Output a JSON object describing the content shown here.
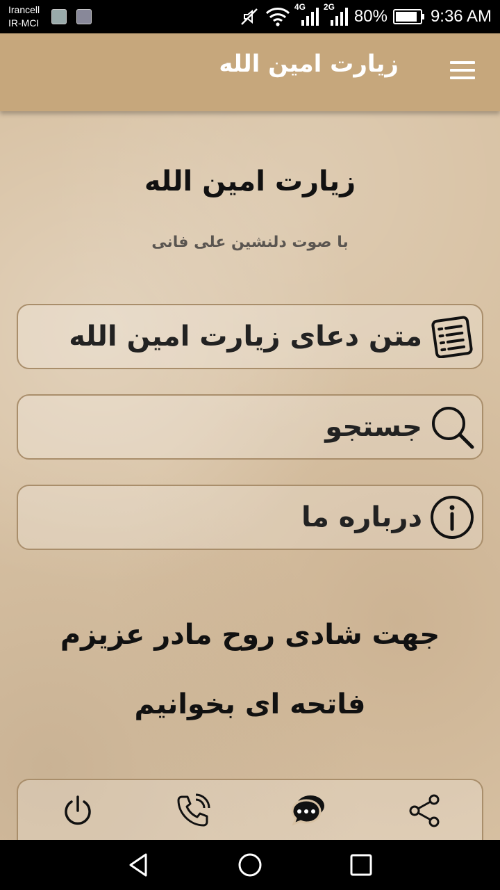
{
  "status_bar": {
    "carrier_1": "Irancell",
    "carrier_2": "IR-MCI",
    "network_1": "4G",
    "network_2": "2G",
    "battery": "80%",
    "time": "9:36 AM"
  },
  "app_bar": {
    "title": "زیارت امین الله"
  },
  "main": {
    "heading": "زیارت امین الله",
    "subheading": "با صوت دلنشین علی فانی",
    "menu": [
      {
        "label": "متن دعای زیارت امین الله",
        "icon": "list-document-icon"
      },
      {
        "label": "جستجو",
        "icon": "search-icon"
      },
      {
        "label": "درباره ما",
        "icon": "info-icon"
      }
    ],
    "dedication_line_1": "جهت شادی روح مادر عزیزم",
    "dedication_line_2": "فاتحه ای بخوانیم"
  },
  "bottom_bar": {
    "icons": [
      "power-icon",
      "phone-call-icon",
      "chat-icon",
      "share-icon"
    ]
  },
  "colors": {
    "app_bar": "#c6a77c",
    "background": "#d8c2a4",
    "card_border": "#a98e6b"
  }
}
